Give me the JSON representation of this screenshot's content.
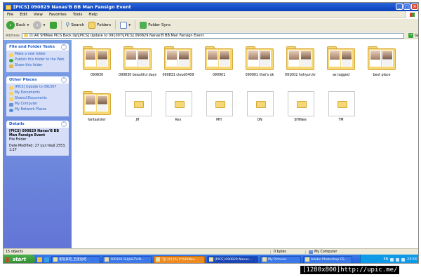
{
  "window": {
    "title": "[PICS] 090829 Nanas'B BB Man Fansign Event"
  },
  "menu": [
    "File",
    "Edit",
    "View",
    "Favorites",
    "Tools",
    "Help"
  ],
  "toolbar": {
    "back": "Back",
    "search": "Search",
    "folders": "Folders",
    "folder_sync": "Folder Sync"
  },
  "address": {
    "label": "Address",
    "value": "D:\\All SHINee PICS Back Up\\[PICS] Update to 091007\\[PICS] 090829 Nanas'B BB Man Fansign Event",
    "go": "Go"
  },
  "sidebar": {
    "file_tasks": {
      "title": "File and Folder Tasks",
      "items": [
        "Make a new folder",
        "Publish this folder to the Web",
        "Share this folder"
      ]
    },
    "other_places": {
      "title": "Other Places",
      "items": [
        "[PICS] Update to 091007",
        "My Documents",
        "Shared Documents",
        "My Computer",
        "My Network Places"
      ]
    },
    "details": {
      "title": "Details",
      "name": "[PICS] 090829 Nanas'B BB Man Fansign Event",
      "type": "File Folder",
      "modified": "Date Modified: 27 กุมภาพันธ์ 2553, 1:27"
    }
  },
  "folders": [
    {
      "label": "090830",
      "style": "thumb"
    },
    {
      "label": "090830 beautiful days",
      "style": "thumb"
    },
    {
      "label": "090831 cloud0409",
      "style": "thumb"
    },
    {
      "label": "090901",
      "style": "thumb"
    },
    {
      "label": "090901 that's ok",
      "style": "thumb"
    },
    {
      "label": "091002 hohyun.kr",
      "style": "thumb"
    },
    {
      "label": "as tagged",
      "style": "thumb"
    },
    {
      "label": "best place",
      "style": "thumb"
    },
    {
      "label": "fantasister",
      "style": "thumb"
    },
    {
      "label": "JH",
      "style": "plain"
    },
    {
      "label": "Key",
      "style": "plain"
    },
    {
      "label": "MH",
      "style": "plain"
    },
    {
      "label": "ON",
      "style": "plain"
    },
    {
      "label": "SHINee",
      "style": "plain"
    },
    {
      "label": "TM",
      "style": "plain"
    }
  ],
  "status": {
    "objects": "15 objects",
    "size": "0 bytes",
    "location": "My Computer"
  },
  "taskbar": {
    "start": "start",
    "buttons": [
      {
        "label": "崔珉豪吧_百度贴吧...",
        "style": "normal"
      },
      {
        "label": "100302 SUJU&TV.N...",
        "style": "normal"
      },
      {
        "label": "\"[J] [A] [A] (*)SHINee...",
        "style": "orange"
      },
      {
        "label": "[PICS] 090829 Nanas...",
        "style": "active"
      },
      {
        "label": "My Pictures",
        "style": "normal"
      },
      {
        "label": "Adobe Photoshop CS...",
        "style": "normal"
      }
    ],
    "tray_lang": "EN",
    "clock": "23:54"
  },
  "watermark": "[1280x800]http://upic.me/"
}
